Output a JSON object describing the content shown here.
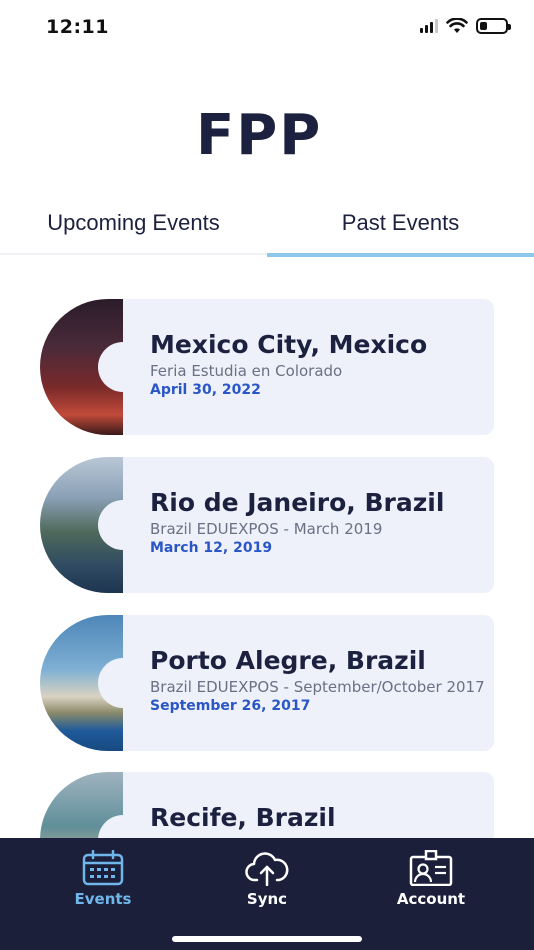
{
  "status_bar": {
    "time": "12:11",
    "battery_level": 0.2
  },
  "logo": {
    "text": "FPP"
  },
  "tabs": [
    {
      "label": "Upcoming Events",
      "active": false
    },
    {
      "label": "Past Events",
      "active": true
    }
  ],
  "events": [
    {
      "city": "Mexico City, Mexico",
      "subtitle": "Feria Estudia en Colorado",
      "date": "April 30, 2022"
    },
    {
      "city": "Rio de Janeiro, Brazil",
      "subtitle": "Brazil EDUEXPOS - March 2019",
      "date": "March 12, 2019"
    },
    {
      "city": "Porto Alegre, Brazil",
      "subtitle": "Brazil EDUEXPOS - September/October 2017",
      "date": "September 26, 2017"
    },
    {
      "city": "Recife, Brazil",
      "subtitle": "",
      "date": ""
    }
  ],
  "bottom_nav": [
    {
      "label": "Events",
      "icon": "calendar-icon",
      "active": true
    },
    {
      "label": "Sync",
      "icon": "cloud-sync-icon",
      "active": false
    },
    {
      "label": "Account",
      "icon": "id-badge-icon",
      "active": false
    }
  ],
  "colors": {
    "brand_dark": "#1c2140",
    "nav_bg": "#1b1f3a",
    "accent_blue": "#2a56c6",
    "tab_underline": "#8cc8ea",
    "card_bg": "#eef1f9",
    "active_nav": "#6fb6ea"
  }
}
